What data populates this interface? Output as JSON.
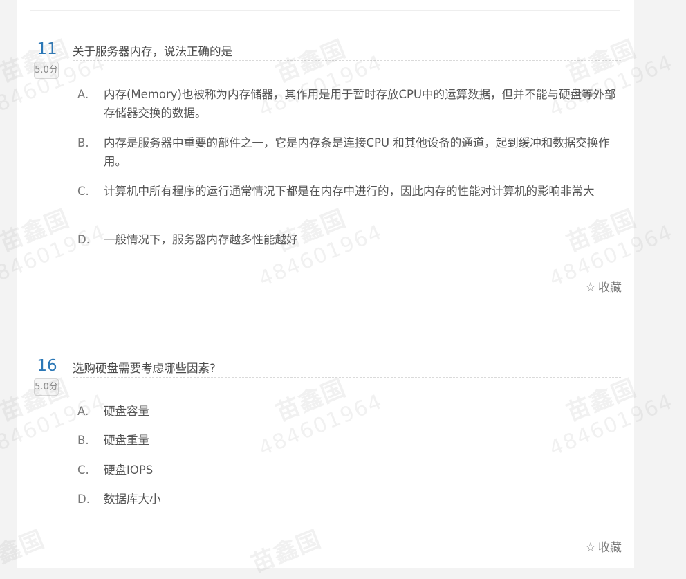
{
  "questions": [
    {
      "number": "11",
      "score": "5.0分",
      "text": "关于服务器内存，说法正确的是",
      "options": [
        {
          "letter": "A.",
          "text": "内存(Memory)也被称为内存储器，其作用是用于暂时存放CPU中的运算数据，但并不能与硬盘等外部存储器交换的数据。"
        },
        {
          "letter": "B.",
          "text": "内存是服务器中重要的部件之一，它是内存条是连接CPU 和其他设备的通道，起到缓冲和数据交换作用。"
        },
        {
          "letter": "C.",
          "text": "计算机中所有程序的运行通常情况下都是在内存中进行的，因此内存的性能对计算机的影响非常大"
        },
        {
          "letter": "D.",
          "text": "一般情况下，服务器内存越多性能越好"
        }
      ],
      "favorite_label": "收藏"
    },
    {
      "number": "16",
      "score": "5.0分",
      "text": "选购硬盘需要考虑哪些因素?",
      "options": [
        {
          "letter": "A.",
          "text": "硬盘容量"
        },
        {
          "letter": "B.",
          "text": "硬盘重量"
        },
        {
          "letter": "C.",
          "text": "硬盘IOPS"
        },
        {
          "letter": "D.",
          "text": "数据库大小"
        }
      ],
      "favorite_label": "收藏"
    }
  ],
  "icons": {
    "favorite": "star-outline-icon"
  },
  "colors": {
    "question_number": "#2b77b6",
    "page_background": "#f3f3f3",
    "panel": "#ffffff"
  },
  "watermark": {
    "name": "苗鑫国",
    "digits": "484601964"
  }
}
